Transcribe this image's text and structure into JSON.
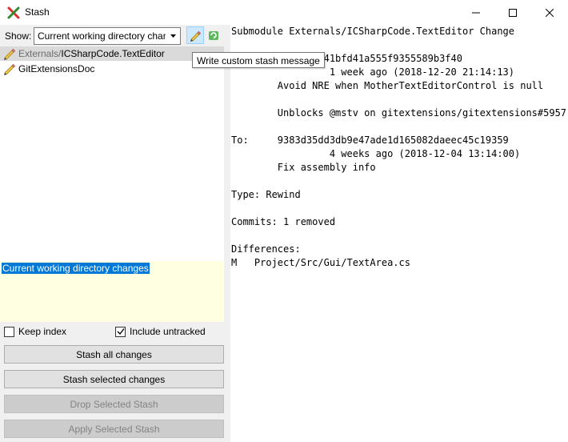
{
  "window": {
    "title": "Stash",
    "icon": "git-extensions-icon",
    "controls": [
      "minimize",
      "maximize",
      "close"
    ]
  },
  "toolbar": {
    "show_label": "Show:",
    "show_value": "Current working directory changes",
    "write_message_icon": "pencil-icon",
    "refresh_icon": "refresh-icon",
    "tooltip": "Write custom stash message"
  },
  "files": [
    {
      "prefix": "Externals/",
      "name": "ICSharpCode.TextEditor",
      "selected": true,
      "icon": "modified-pencil-icon"
    },
    {
      "prefix": "",
      "name": "GitExtensionsDoc",
      "selected": false,
      "icon": "modified-pencil-icon"
    }
  ],
  "message": {
    "selected_text": "Current working directory changes"
  },
  "options": {
    "keep_index_label": "Keep index",
    "keep_index_checked": false,
    "include_untracked_label": "Include untracked",
    "include_untracked_checked": true
  },
  "buttons": {
    "stash_all": "Stash all changes",
    "stash_selected": "Stash selected changes",
    "drop_selected": "Drop Selected Stash",
    "apply_selected": "Apply Selected Stash"
  },
  "diff": {
    "lines": [
      "Submodule Externals/ICSharpCode.TextEditor Change",
      "",
      "From:   ce35d53241bfd41a555f9355589b3f40",
      "                 1 week ago (2018-12-20 21:14:13)",
      "        Avoid NRE when MotherTextEditorControl is null",
      "",
      "        Unblocks @mstv on gitextensions/gitextensions#5957",
      "",
      "To:     9383d35dd3db9e47ade1d165082daeec45c19359",
      "                 4 weeks ago (2018-12-04 13:14:00)",
      "        Fix assembly info",
      "",
      "Type: Rewind",
      "",
      "Commits: 1 removed",
      "",
      "Differences:",
      "M   Project/Src/Gui/TextArea.cs"
    ]
  },
  "colors": {
    "selection_blue": "#0078d7",
    "message_bg": "#ffffe1",
    "button_bg": "#e1e1e1",
    "disabled_bg": "#cccccc"
  }
}
